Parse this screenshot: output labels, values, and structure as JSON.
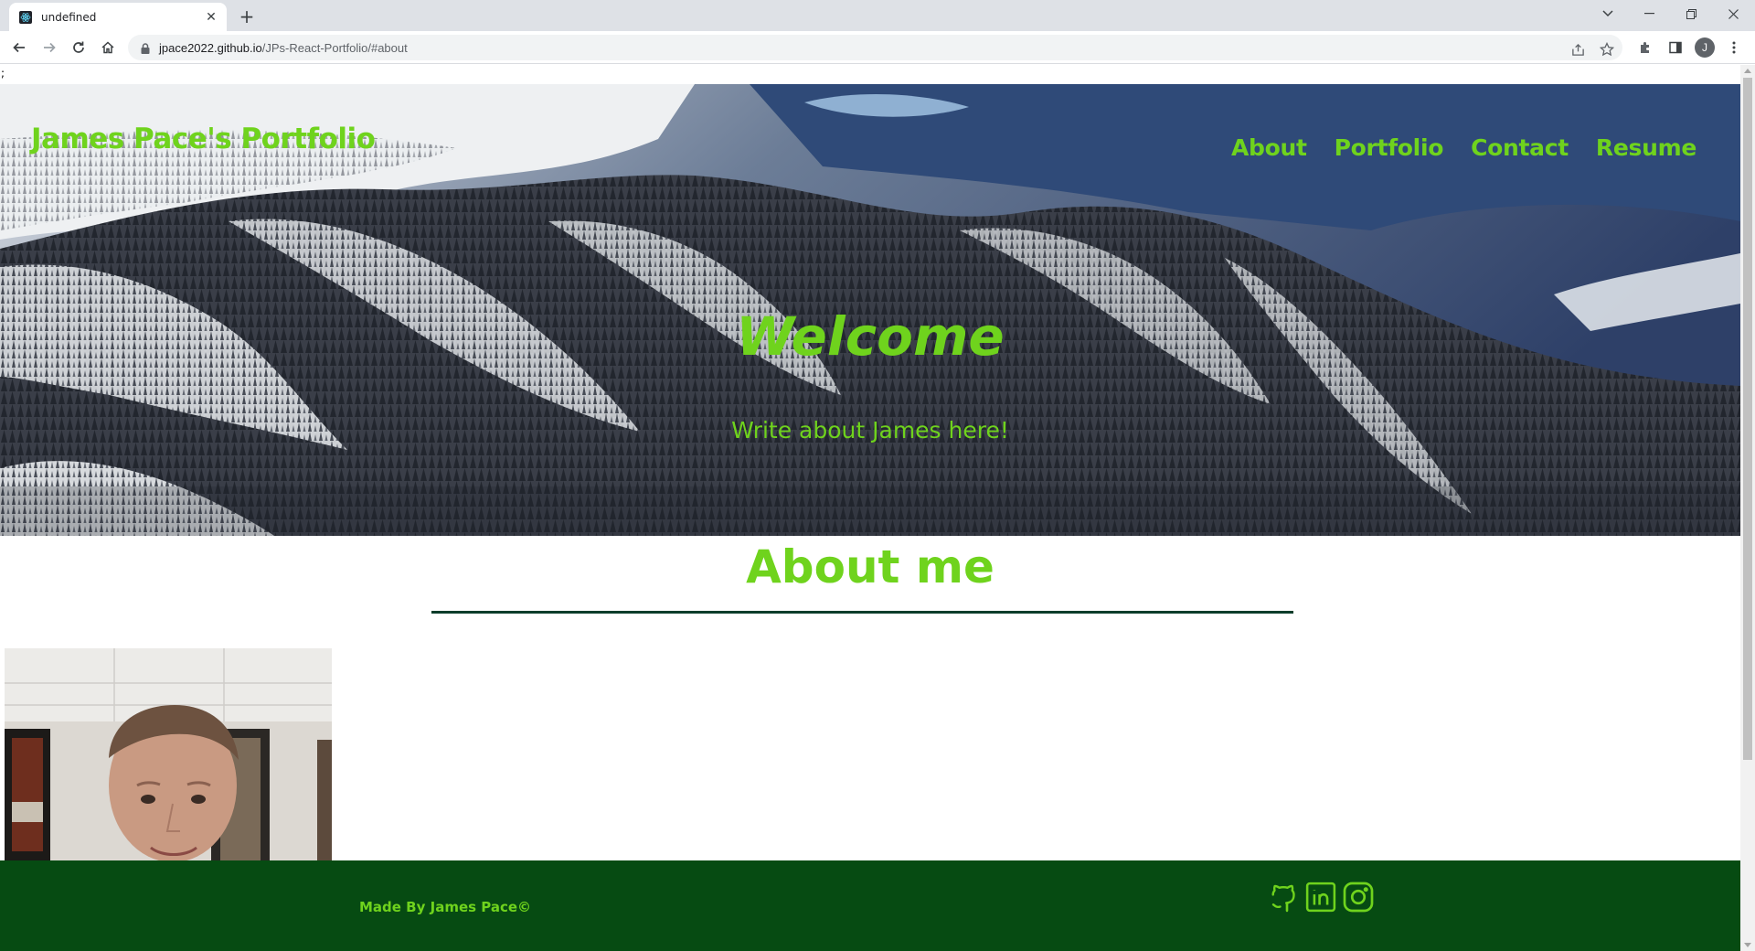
{
  "browser": {
    "tab_title": "undefined",
    "url_host": "jpace2022.github.io",
    "url_path": "/JPs-React-Portfolio/#about",
    "profile_initial": "J"
  },
  "page": {
    "stray_char": ";",
    "header": {
      "site_title": "James Pace's Portfolio",
      "nav": [
        "About",
        "Portfolio",
        "Contact",
        "Resume"
      ]
    },
    "hero": {
      "heading": "Welcome",
      "subtext": "Write about James here!"
    },
    "about": {
      "heading": "About me"
    },
    "footer": {
      "credit": "Made By James Pace©",
      "social": [
        "github-icon",
        "linkedin-icon",
        "instagram-icon"
      ]
    }
  },
  "colors": {
    "accent_green": "#6fd31d",
    "footer_bg": "#064b12",
    "rule": "#0b3d2a"
  }
}
